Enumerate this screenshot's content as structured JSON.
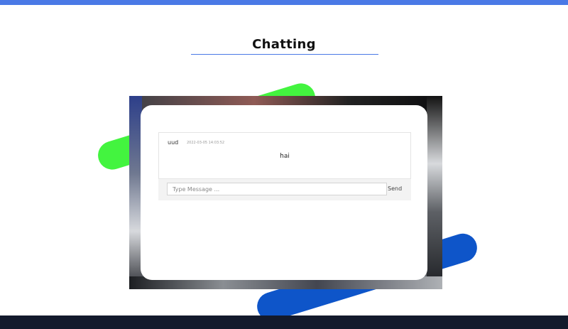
{
  "page": {
    "title": "Chatting"
  },
  "chat": {
    "messages": [
      {
        "user": "uud",
        "time": "2022-03-05 14:03:52",
        "text": "hai"
      }
    ],
    "input": {
      "placeholder": "Type Message ...",
      "value": ""
    },
    "send_label": "Send"
  },
  "colors": {
    "top_bar": "#4a79e6",
    "footer": "#131a2c",
    "green_stroke": "#43f43f",
    "blue_stroke": "#0e55c9"
  }
}
